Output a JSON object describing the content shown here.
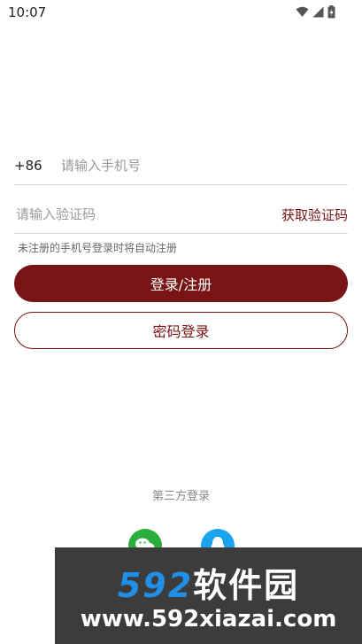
{
  "status_bar": {
    "time": "10:07",
    "icons": [
      "wifi-icon",
      "signal-icon",
      "battery-icon"
    ]
  },
  "login_form": {
    "country_code": "+86",
    "phone_placeholder": "请输入手机号",
    "code_placeholder": "请输入验证码",
    "get_code_label": "获取验证码",
    "hint": "未注册的手机号登录时将自动注册",
    "login_button": "登录/注册",
    "password_login_button": "密码登录"
  },
  "third_party": {
    "title": "第三方登录",
    "providers": [
      "wechat-icon",
      "qq-icon"
    ]
  },
  "watermark": {
    "brand_number": "592",
    "brand_text": "软件园",
    "url": "www.592xiazai.com"
  },
  "colors": {
    "accent": "#781413",
    "wechat": "#2aae3b",
    "qq": "#1aa3ef",
    "watermark_bg": "#3c3c3c",
    "watermark_blue": "#1f8fe8"
  }
}
